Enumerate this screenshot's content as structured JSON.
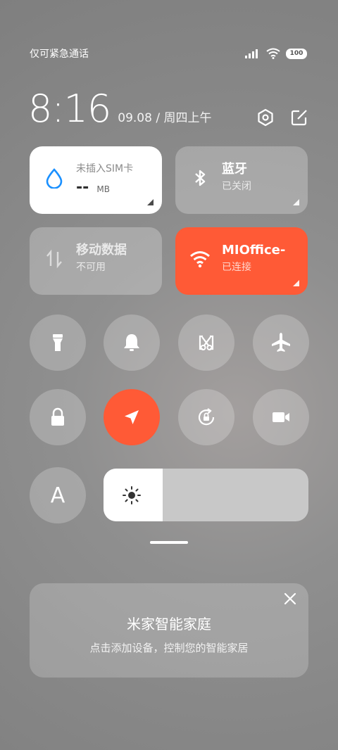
{
  "status_bar": {
    "carrier": "仅可紧急通话",
    "battery": "100",
    "icons": [
      "signal-icon",
      "wifi-icon",
      "battery-icon"
    ]
  },
  "header": {
    "time": "8:16",
    "date": "09.08 / 周四上午",
    "icons": [
      "settings-icon",
      "edit-icon"
    ]
  },
  "tiles": {
    "data_usage": {
      "title": "未插入SIM卡",
      "value": "--",
      "unit": "MB",
      "icon": "water-drop-icon"
    },
    "bluetooth": {
      "title": "蓝牙",
      "status": "已关闭",
      "icon": "bluetooth-icon"
    },
    "mobile_data": {
      "title": "移动数据",
      "status": "不可用",
      "icon": "data-arrows-icon"
    },
    "wifi": {
      "title": "MIOffice-",
      "status": "已连接",
      "icon": "wifi-icon"
    }
  },
  "toggles": [
    {
      "name": "flashlight-icon",
      "active": false
    },
    {
      "name": "bell-icon",
      "active": false
    },
    {
      "name": "screenshot-icon",
      "active": false
    },
    {
      "name": "airplane-icon",
      "active": false
    },
    {
      "name": "lock-icon",
      "active": false
    },
    {
      "name": "location-icon",
      "active": true
    },
    {
      "name": "rotation-lock-icon",
      "active": false
    },
    {
      "name": "video-camera-icon",
      "active": false
    }
  ],
  "font_button": {
    "label": "A"
  },
  "brightness": {
    "level": 0.29,
    "icon": "sun-icon"
  },
  "smart_home": {
    "title": "米家智能家庭",
    "subtitle": "点击添加设备，控制您的智能家居",
    "close_icon": "close-icon"
  },
  "colors": {
    "accent": "#ff5a36",
    "wifi_blue": "#1a90ff"
  }
}
